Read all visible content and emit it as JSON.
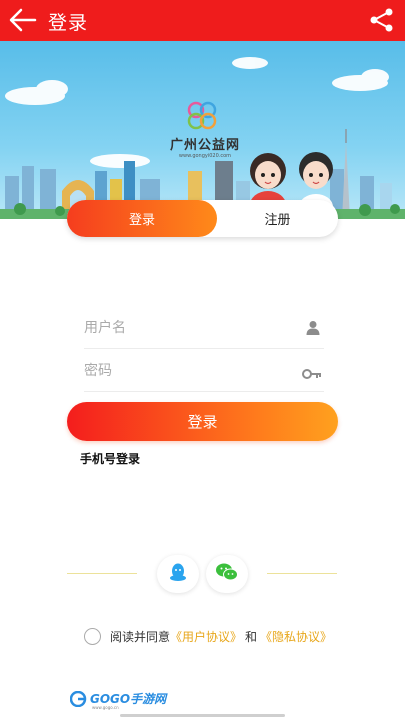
{
  "appbar": {
    "title": "登录"
  },
  "banner": {
    "logo_name": "广州公益网",
    "logo_url": "www.gongyi020.com"
  },
  "tabs": {
    "login": "登录",
    "register": "注册"
  },
  "form": {
    "username_placeholder": "用户名",
    "password_placeholder": "密码",
    "login_button": "登录",
    "phone_login": "手机号登录"
  },
  "social": {
    "items": [
      "qq-icon",
      "wechat-icon"
    ]
  },
  "agreement": {
    "prefix": "阅读并同意",
    "user_agreement": "《用户协议》",
    "conjunction": "和",
    "privacy_policy": "《隐私协议》"
  },
  "watermark": {
    "text": "GOGO手游网",
    "sub": "www.gogo.cn"
  },
  "colors": {
    "accent_red": "#ef1c1c",
    "gradient_orange": "#ff8a1a",
    "link": "#e8a71b"
  }
}
